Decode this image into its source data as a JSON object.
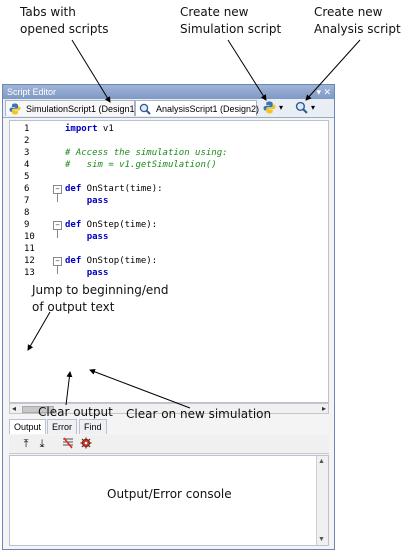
{
  "annotations": {
    "tabs_with_scripts": "Tabs with\nopened scripts",
    "create_simulation": "Create new\nSimulation script",
    "create_analysis": "Create new\nAnalysis script",
    "jump_output": "Jump to beginning/end\nof output text",
    "clear_output": "Clear output",
    "clear_on_new_sim": "Clear on new simulation",
    "console_label": "Output/Error console"
  },
  "window": {
    "title": "Script Editor",
    "controls": "▾ ✕"
  },
  "tabs": [
    {
      "label": "SimulationScript1 (Design1)",
      "icon": "python-icon"
    },
    {
      "label": "AnalysisScript1 (Design2)",
      "icon": "magnifier-icon"
    }
  ],
  "toolbar": {
    "new_simulation_icon": "python-icon",
    "new_analysis_icon": "magnifier-icon",
    "dropdown": "▾"
  },
  "code_lines": [
    {
      "n": "1",
      "text": "import v1",
      "fold": false
    },
    {
      "n": "2",
      "text": "",
      "fold": false
    },
    {
      "n": "3",
      "text": "# Access the simulation using:",
      "fold": false
    },
    {
      "n": "4",
      "text": "#   sim = v1.getSimulation()",
      "fold": false
    },
    {
      "n": "5",
      "text": "",
      "fold": false
    },
    {
      "n": "6",
      "text": "def OnStart(time):",
      "fold": true
    },
    {
      "n": "7",
      "text": "    pass",
      "fold": false
    },
    {
      "n": "8",
      "text": "",
      "fold": false
    },
    {
      "n": "9",
      "text": "def OnStep(time):",
      "fold": true
    },
    {
      "n": "10",
      "text": "    pass",
      "fold": false
    },
    {
      "n": "11",
      "text": "",
      "fold": false
    },
    {
      "n": "12",
      "text": "def OnStop(time):",
      "fold": true
    },
    {
      "n": "13",
      "text": "    pass",
      "fold": false
    }
  ],
  "output_tabs": [
    "Output",
    "Error",
    "Find"
  ],
  "output_toolbar": {
    "jump_begin_icon": "⤒",
    "jump_end_icon": "⤓",
    "clear_icon": "clear-output-icon",
    "clear_on_new_icon": "gear-icon"
  }
}
